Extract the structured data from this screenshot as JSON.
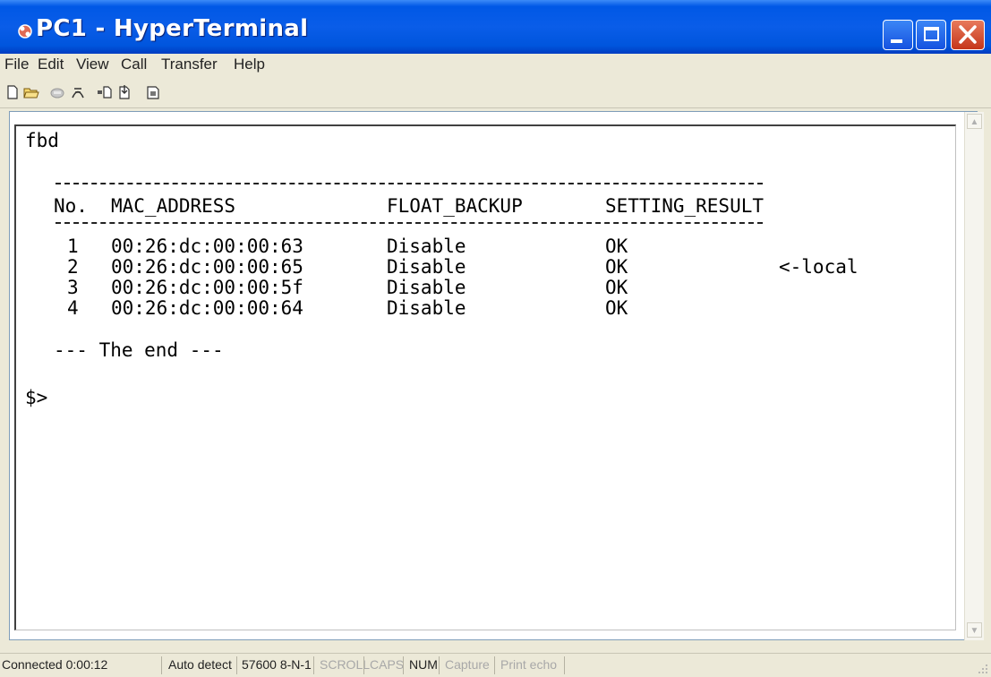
{
  "window": {
    "title": "PC1 - HyperTerminal"
  },
  "menu": [
    "File",
    "Edit",
    "View",
    "Call",
    "Transfer",
    "Help"
  ],
  "toolbar": [
    "new-icon",
    "open-icon",
    "disconnect-icon",
    "dial-icon",
    "send-icon",
    "receive-icon",
    "properties-icon"
  ],
  "terminal": {
    "command": "fbd",
    "headers": [
      "No.",
      "MAC_ADDRESS",
      "FLOAT_BACKUP",
      "SETTING_RESULT"
    ],
    "rows": [
      {
        "no": "1",
        "mac": "00:26:dc:00:00:63",
        "float": "Disable",
        "result": "OK",
        "note": ""
      },
      {
        "no": "2",
        "mac": "00:26:dc:00:00:65",
        "float": "Disable",
        "result": "OK",
        "note": "<-local"
      },
      {
        "no": "3",
        "mac": "00:26:dc:00:00:5f",
        "float": "Disable",
        "result": "OK",
        "note": ""
      },
      {
        "no": "4",
        "mac": "00:26:dc:00:00:64",
        "float": "Disable",
        "result": "OK",
        "note": ""
      }
    ],
    "end": "--- The end ---",
    "prompt": "$>"
  },
  "status": {
    "connected": "Connected 0:00:12",
    "detect": "Auto detect",
    "settings": "57600 8-N-1",
    "scroll": "SCROLL",
    "caps": "CAPS",
    "num": "NUM",
    "capture": "Capture",
    "echo": "Print echo"
  }
}
